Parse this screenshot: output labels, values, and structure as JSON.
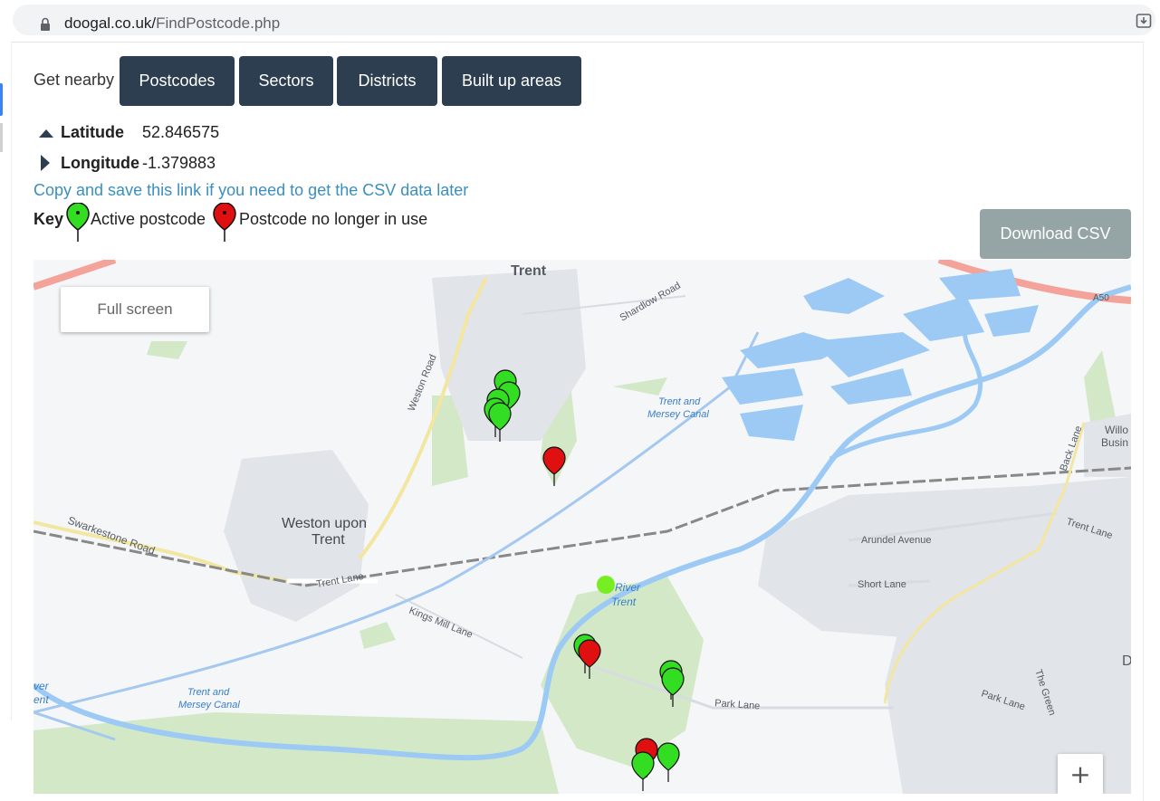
{
  "browser": {
    "url_host": "doogal.co.uk/",
    "url_path": "FindPostcode.php"
  },
  "nearby": {
    "label": "Get nearby",
    "buttons": [
      "Postcodes",
      "Sectors",
      "Districts",
      "Built up areas"
    ]
  },
  "coords": {
    "latitude_label": "Latitude",
    "latitude_value": "52.846575",
    "longitude_label": "Longitude",
    "longitude_value": "-1.379883"
  },
  "link_text": "Copy and save this link if you need to get the CSV data later",
  "key": {
    "label": "Key",
    "active": "Active postcode",
    "inactive": "Postcode no longer in use"
  },
  "download_csv": "Download CSV",
  "map": {
    "full_screen": "Full screen",
    "zoom_in": "+",
    "labels": {
      "trent": "Trent",
      "shardlow_road": "Shardlow Road",
      "weston_road": "Weston Road",
      "canal_1_line1": "Trent and",
      "canal_1_line2": "Mersey Canal",
      "canal_2_line1": "Trent and",
      "canal_2_line2": "Mersey Canal",
      "a50": "A50",
      "willo": "Willo",
      "busin": "Busin",
      "back_lane": "Back Lane",
      "swarkestone_road": "Swarkestone Road",
      "weston_upon": "Weston upon",
      "weston_trent": "Trent",
      "arundel_avenue": "Arundel Avenue",
      "trent_lane_east": "Trent Lane",
      "short_lane": "Short Lane",
      "trent_lane_west": "Trent Lane",
      "river_trent_1": "River",
      "river_trent_2": "Trent",
      "kings_mill_lane": "Kings Mill Lane",
      "park_lane_1": "Park Lane",
      "park_lane_2": "Park Lane",
      "the_green": "The Green",
      "river_left_1": "ver",
      "river_left_2": "ent",
      "d_edge": "D"
    },
    "colors": {
      "water": "#a4c8f0",
      "greenery": "#d3e8c6",
      "builtup": "#e1e4e8",
      "active_pin": "#33dd22",
      "inactive_pin": "#e01010",
      "major_road": "#f3a39a"
    }
  }
}
